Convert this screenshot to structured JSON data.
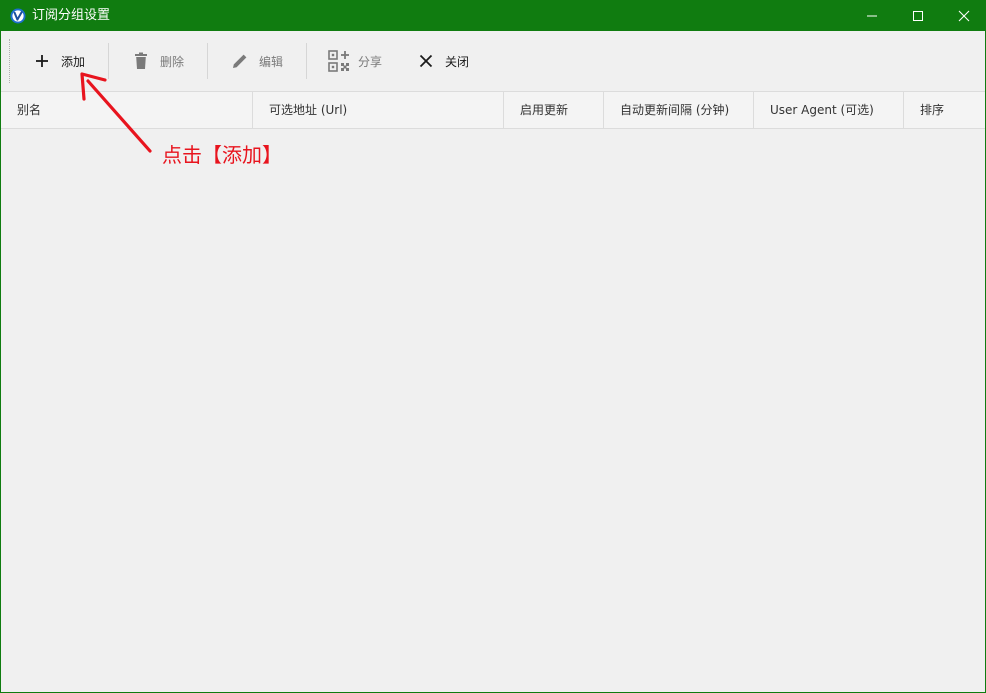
{
  "window": {
    "title": "订阅分组设置",
    "accent_color": "#107c10",
    "icon": "v2rayn-app-icon",
    "controls": [
      "minimize-icon",
      "maximize-icon",
      "close-icon"
    ]
  },
  "toolbar": {
    "add_label": "添加",
    "delete_label": "删除",
    "edit_label": "编辑",
    "share_label": "分享",
    "close_label": "关闭"
  },
  "table": {
    "columns": [
      "别名",
      "可选地址 (Url)",
      "启用更新",
      "自动更新间隔 (分钟)",
      "User Agent (可选)",
      "排序"
    ],
    "rows": []
  },
  "annotation": {
    "text": "点击【添加】",
    "color": "#e8141e"
  }
}
